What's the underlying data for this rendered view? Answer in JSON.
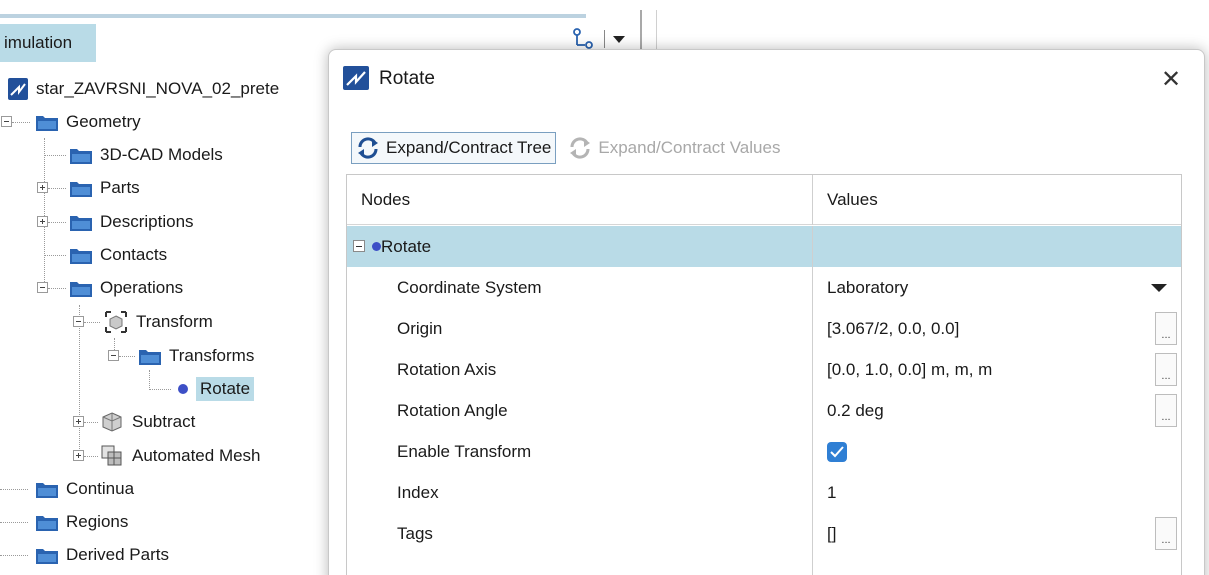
{
  "simulation_panel": {
    "tab_label": "imulation",
    "tree": {
      "root": "star_ZAVRSNI_NOVA_02_prete",
      "geometry": "Geometry",
      "cad_models": "3D-CAD Models",
      "parts": "Parts",
      "descriptions": "Descriptions",
      "contacts": "Contacts",
      "operations": "Operations",
      "transform": "Transform",
      "transforms": "Transforms",
      "rotate": "Rotate",
      "subtract": "Subtract",
      "automated_mesh": "Automated Mesh",
      "continua": "Continua",
      "regions": "Regions",
      "derived_parts": "Derived Parts"
    }
  },
  "dialog": {
    "title": "Rotate",
    "close_symbol": "✕",
    "toolbar": {
      "expand_tree": "Expand/Contract Tree",
      "expand_values": "Expand/Contract Values"
    },
    "grid": {
      "header_nodes": "Nodes",
      "header_values": "Values",
      "group": {
        "node": "Rotate",
        "value": ""
      },
      "rows": [
        {
          "node": "Coordinate System",
          "value": "Laboratory"
        },
        {
          "node": "Origin",
          "value": "[3.067/2, 0.0, 0.0]"
        },
        {
          "node": "Rotation Axis",
          "value": "[0.0, 1.0, 0.0] m, m, m"
        },
        {
          "node": "Rotation Angle",
          "value": "0.2 deg"
        },
        {
          "node": "Enable Transform",
          "value": ""
        },
        {
          "node": "Index",
          "value": "1"
        },
        {
          "node": "Tags",
          "value": "[]"
        }
      ],
      "ellipsis": "...",
      "enable_transform_checked": true
    }
  },
  "colors": {
    "selection": "#b9dbe7",
    "checkbox": "#2f7fd4",
    "folder": "#2a63b0",
    "node_dot": "#3d4fc6"
  }
}
